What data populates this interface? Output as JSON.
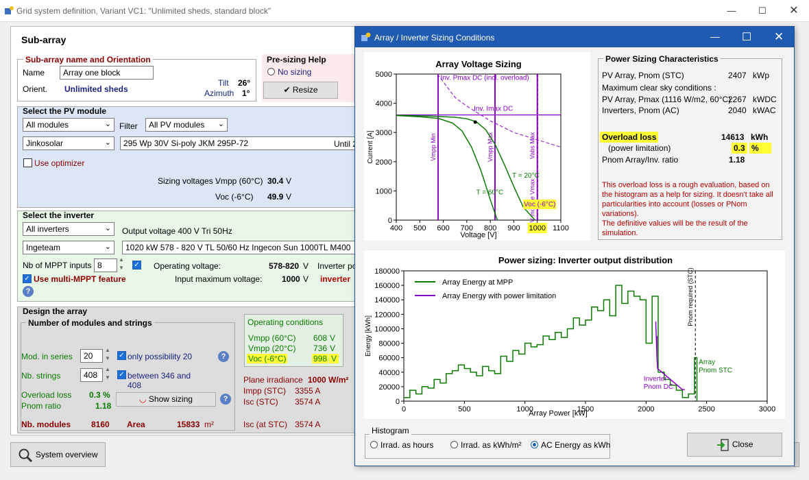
{
  "window": {
    "title": "Grid system definition, Variant VC1:   \"Unlimited sheds, standard block\""
  },
  "sub_array": {
    "title": "Sub-array",
    "name_group": {
      "title": "Sub-array name and Orientation",
      "name_label": "Name",
      "name_value": "Array one block",
      "orient_label": "Orient.",
      "orient_value": "Unlimited sheds",
      "tilt_label": "Tilt",
      "tilt_value": "26°",
      "azimuth_label": "Azimuth",
      "azimuth_value": "1°"
    },
    "presizing": {
      "title": "Pre-sizing Help",
      "option": "No sizing",
      "resize_button": "Resize"
    },
    "pv_module": {
      "title": "Select the PV module",
      "filter_value": "All modules",
      "filter_label": "Filter",
      "filter2_value": "All PV modules",
      "manufacturer": "Jinkosolar",
      "model": "295 Wp 30V       Si-poly          JKM 295P-72",
      "until": "Until 2",
      "optimizer_label": "Use optimizer",
      "sizing_voltages_label": "Sizing voltages :",
      "vmpp_label": "Vmpp (60°C)",
      "vmpp_value": "30.4",
      "voc_label": "Voc (-6°C)",
      "voc_value": "49.9",
      "unit_v": "V"
    },
    "inverter": {
      "title": "Select the inverter",
      "filter_value": "All inverters",
      "output_voltage": "Output voltage 400 V Tri 50Hz",
      "manufacturer": "Ingeteam",
      "model": "1020 kW   578 - 820 V    TL          50/60 Hz   Ingecon Sun 1000TL M400",
      "mppt_label": "Nb of MPPT inputs",
      "mppt_value": "8",
      "op_voltage_label": "Operating voltage:",
      "op_voltage_value": "578-820",
      "unit_v": "V",
      "inverter_po": "Inverter po",
      "multi_mppt_label": "Use multi-MPPT feature",
      "input_max_label": "Input maximum voltage:",
      "input_max_value": "1000",
      "inverter_red": "inverter"
    },
    "design": {
      "title": "Design the array",
      "strings_title": "Number of modules and strings",
      "mod_series_label": "Mod. in series",
      "mod_series_value": "20",
      "only_possibility": "only possibility 20",
      "nb_strings_label": "Nb. strings",
      "nb_strings_value": "408",
      "between_line1": "between 346 and",
      "between_line2": "408",
      "overload_label": "Overload loss",
      "overload_value": "0.3 %",
      "pnom_ratio_label": "Pnom ratio",
      "pnom_ratio_value": "1.18",
      "show_sizing_button": "Show sizing",
      "nb_modules_label": "Nb. modules",
      "nb_modules_value": "8160",
      "area_label": "Area",
      "area_value": "15833",
      "area_unit": "m²"
    },
    "operating": {
      "title": "Operating conditions",
      "vmpp60_label": "Vmpp (60°C)",
      "vmpp60_value": "608",
      "vmpp20_label": "Vmpp (20°C)",
      "vmpp20_value": "736",
      "voc_label": "Voc (-6°C)",
      "voc_value": "998",
      "unit_v": "V"
    },
    "irradiance": {
      "label": "Plane irradiance",
      "value": "1000 W/m²",
      "impp_label": "Impp (STC)",
      "impp_value": "3355 A",
      "isc_label": "Isc (STC)",
      "isc_value": "3574 A",
      "isc_at_label": "Isc (at STC)",
      "isc_at_value": "3574 A"
    },
    "system_overview_button": "System overview"
  },
  "dialog": {
    "title": "Array / Inverter Sizing Conditions",
    "power_sizing": {
      "title": "Power Sizing Characteristics",
      "pv_pnom_label": "PV Array, Pnom (STC)",
      "pv_pnom_value": "2407",
      "pv_pnom_unit": "kWp",
      "max_clear_label": "Maximum clear sky conditions :",
      "pv_pmax_label": "PV Array, Pmax (1116 W/m2, 60°C)",
      "pv_pmax_value": "2267",
      "pv_pmax_unit": "kWDC",
      "inv_pnom_label": "Inverters, Pnom (AC)",
      "inv_pnom_value": "2040",
      "inv_pnom_unit": "kWAC",
      "overload_label": "Overload loss",
      "overload_value": "14613",
      "overload_unit": "kWh",
      "power_limit_label": "(power limitation)",
      "power_limit_value": "0.3",
      "power_limit_unit": "%",
      "ratio_label": "Pnom Array/Inv. ratio",
      "ratio_value": "1.18",
      "note_line1": "This overload loss is a rough evaluation, based on",
      "note_line2": "the histogram as a help for sizing. It doesn't take all",
      "note_line3": "particularities into account (losses or PNom",
      "note_line4": "variations).",
      "note_line5": "The definitive values will be the result of the",
      "note_line6": "simulation."
    },
    "histogram": {
      "title": "Histogram",
      "opt1": "Irrad. as hours",
      "opt2": "Irrad. as kWh/m²",
      "opt3": "AC Energy as kWh"
    },
    "close_button": "Close"
  },
  "chart_data": [
    {
      "type": "line",
      "title": "Array Voltage Sizing",
      "xlabel": "Voltage [V]",
      "ylabel": "Current [A]",
      "xlim": [
        400,
        1100
      ],
      "ylim": [
        0,
        5000
      ],
      "xticks": [
        400,
        500,
        600,
        700,
        800,
        900,
        1000,
        1100
      ],
      "yticks": [
        0,
        1000,
        2000,
        3000,
        4000,
        5000
      ],
      "series": [
        {
          "name": "T = 60°C",
          "x": [
            400,
            500,
            580,
            640,
            680,
            720,
            760,
            800,
            830
          ],
          "y": [
            3580,
            3540,
            3480,
            3320,
            3050,
            2500,
            1700,
            700,
            0
          ]
        },
        {
          "name": "T = 20°C",
          "x": [
            400,
            550,
            650,
            700,
            740,
            780,
            820,
            860,
            900,
            940,
            990
          ],
          "y": [
            3590,
            3560,
            3520,
            3470,
            3370,
            3100,
            2600,
            1900,
            1150,
            450,
            0
          ]
        }
      ],
      "vlines": [
        {
          "label": "Vmpp Min",
          "x": 578
        },
        {
          "label": "Vmpp Max",
          "x": 820
        },
        {
          "label": "Vabs Max",
          "x": 1000
        },
        {
          "label": "PV module Vmax",
          "x": 1000
        }
      ],
      "hlines": [
        {
          "label": "Inv. Imax DC",
          "y": 3600
        }
      ],
      "curves": [
        {
          "label": "Inv. Pmax DC (incl. overload)",
          "x": [
            575,
            650,
            700,
            800,
            900,
            1000,
            1100
          ],
          "y": [
            5000,
            4200,
            3900,
            3400,
            3000,
            2750,
            2500
          ]
        }
      ],
      "annotations": [
        "Voc (-6°C)"
      ]
    },
    {
      "type": "line",
      "title": "Power sizing: Inverter output distribution",
      "xlabel": "Array Power [kW]",
      "ylabel": "Energy [kWh]",
      "xlim": [
        0,
        3000
      ],
      "ylim": [
        0,
        180000
      ],
      "xticks": [
        0,
        500,
        1000,
        1500,
        2000,
        2500,
        3000
      ],
      "yticks": [
        0,
        20000,
        40000,
        60000,
        80000,
        100000,
        120000,
        140000,
        160000,
        180000
      ],
      "legend": "top-left",
      "series": [
        {
          "name": "Array Energy at MPP",
          "x": [
            0,
            50,
            100,
            150,
            200,
            250,
            300,
            350,
            400,
            450,
            500,
            550,
            600,
            650,
            700,
            750,
            800,
            850,
            900,
            950,
            1000,
            1050,
            1100,
            1150,
            1200,
            1250,
            1300,
            1350,
            1400,
            1450,
            1500,
            1550,
            1600,
            1650,
            1700,
            1750,
            1800,
            1850,
            1900,
            1950,
            2000,
            2050,
            2100,
            2150,
            2200,
            2250,
            2300,
            2350,
            2400,
            2420
          ],
          "y": [
            5000,
            15000,
            10000,
            20000,
            18000,
            30000,
            25000,
            38000,
            42000,
            50000,
            45000,
            40000,
            35000,
            48000,
            42000,
            38000,
            62000,
            55000,
            70000,
            65000,
            80000,
            75000,
            78000,
            90000,
            85000,
            95000,
            88000,
            100000,
            115000,
            105000,
            112000,
            130000,
            125000,
            140000,
            118000,
            160000,
            135000,
            152000,
            145000,
            140000,
            80000,
            145000,
            40000,
            30000,
            22000,
            15000,
            5000,
            10000,
            60000,
            0
          ]
        },
        {
          "name": "Array Energy with power limitation",
          "x": [
            2080,
            2090,
            2095,
            2300,
            2320
          ],
          "y": [
            110000,
            60000,
            45000,
            16000,
            16000
          ]
        }
      ],
      "annotations": [
        "Inverter Pnom DC",
        "Array Pnom STC",
        "Pnom required (STC)"
      ]
    }
  ],
  "colors": {
    "title_blue": "#1f5bb0",
    "green": "#0a7a00",
    "purple": "#8a00c8",
    "highlight": "#ffff33",
    "maroon": "#8a0000"
  }
}
